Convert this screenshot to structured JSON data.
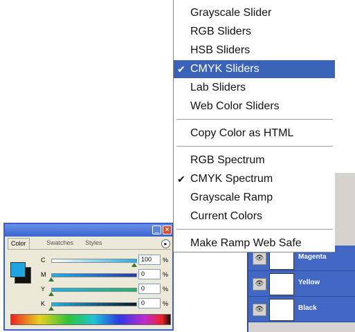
{
  "menu": {
    "groups": [
      [
        {
          "label": "Grayscale Slider",
          "checked": false,
          "selected": false
        },
        {
          "label": "RGB Sliders",
          "checked": false,
          "selected": false
        },
        {
          "label": "HSB Sliders",
          "checked": false,
          "selected": false
        },
        {
          "label": "CMYK Sliders",
          "checked": true,
          "selected": true
        },
        {
          "label": "Lab Sliders",
          "checked": false,
          "selected": false
        },
        {
          "label": "Web Color Sliders",
          "checked": false,
          "selected": false
        }
      ],
      [
        {
          "label": "Copy Color as HTML",
          "checked": false,
          "selected": false
        }
      ],
      [
        {
          "label": "RGB Spectrum",
          "checked": false,
          "selected": false
        },
        {
          "label": "CMYK Spectrum",
          "checked": true,
          "selected": false
        },
        {
          "label": "Grayscale Ramp",
          "checked": false,
          "selected": false
        },
        {
          "label": "Current Colors",
          "checked": false,
          "selected": false
        }
      ],
      [
        {
          "label": "Make Ramp Web Safe",
          "checked": false,
          "selected": false
        }
      ]
    ],
    "check_glyph": "✔"
  },
  "color_panel": {
    "tabs": [
      "Color",
      "Swatches",
      "Styles"
    ],
    "active_tab": "Color",
    "foreground_color": "#1fa4e0",
    "background_color": "#111111",
    "sliders": [
      {
        "letter": "C",
        "value": "100",
        "unit": "%",
        "fraction": 1.0,
        "track": "linear-gradient(to right, #ffffff, #1fb0e8)"
      },
      {
        "letter": "M",
        "value": "0",
        "unit": "%",
        "fraction": 0.0,
        "track": "linear-gradient(to right, #1fb0e8, #2a3aa6)"
      },
      {
        "letter": "Y",
        "value": "0",
        "unit": "%",
        "fraction": 0.0,
        "track": "linear-gradient(to right, #1fb0e8, #2ab06a)"
      },
      {
        "letter": "K",
        "value": "0",
        "unit": "%",
        "fraction": 0.0,
        "track": "linear-gradient(to right, #1fb0e8, #0a1a22)"
      }
    ]
  },
  "channels": {
    "rows": [
      {
        "label": "Magenta"
      },
      {
        "label": "Yellow"
      },
      {
        "label": "Black"
      }
    ]
  },
  "colors": {
    "menu_highlight": "#3a63b8",
    "channel_row": "#4166c4",
    "panel_border": "#3a5fcd"
  }
}
